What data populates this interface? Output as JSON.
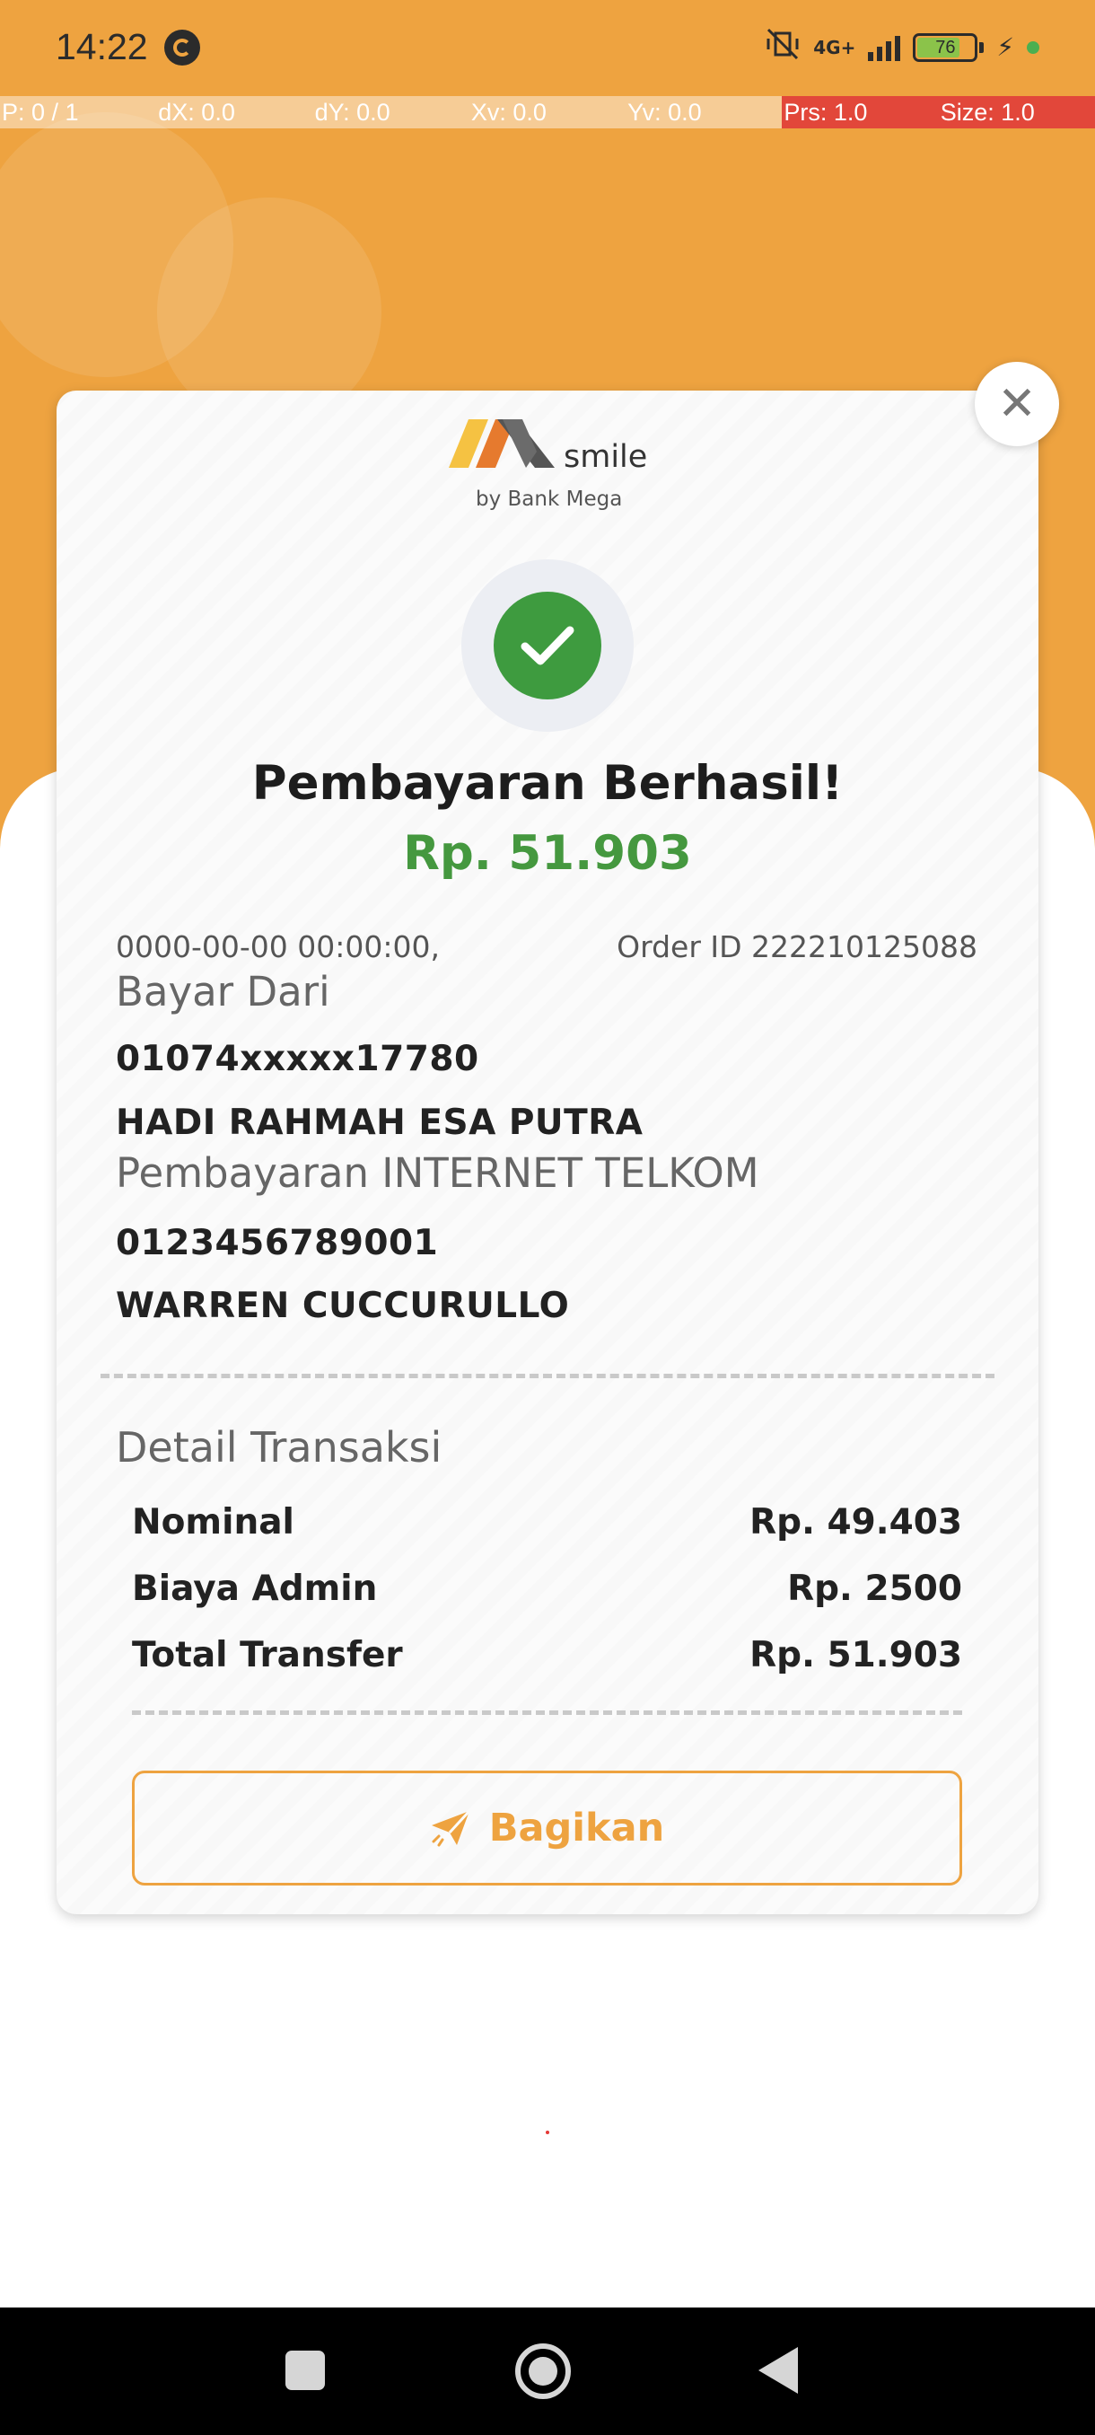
{
  "status_bar": {
    "time": "14:22",
    "network_label": "4G+",
    "battery_level": "76",
    "battery_fraction": 0.76
  },
  "debug_overlay": {
    "pointer": "P: 0 / 1",
    "dx": "dX: 0.0",
    "dy": "dY: 0.0",
    "xv": "Xv: 0.0",
    "yv": "Yv: 0.0",
    "prs": "Prs: 1.0",
    "size": "Size: 1.0"
  },
  "brand": {
    "name": "smile",
    "subtitle": "by Bank Mega"
  },
  "receipt": {
    "title": "Pembayaran Berhasil!",
    "amount": "Rp. 51.903",
    "datetime": "0000-00-00 00:00:00,",
    "order_id": "Order ID 222210125088",
    "from_label": "Bayar Dari",
    "from_account": "01074xxxxx17780",
    "from_name": "HADI RAHMAH ESA PUTRA",
    "payment_label": "Pembayaran INTERNET TELKOM",
    "customer_number": "0123456789001",
    "customer_name": "WARREN CUCCURULLO"
  },
  "details": {
    "title": "Detail Transaksi",
    "rows": [
      {
        "label": "Nominal",
        "value": "Rp. 49.403"
      },
      {
        "label": "Biaya Admin",
        "value": "Rp. 2500"
      },
      {
        "label": "Total Transfer",
        "value": "Rp. 51.903"
      }
    ]
  },
  "actions": {
    "share_label": "Bagikan"
  },
  "colors": {
    "primary_orange": "#eea340",
    "success_green": "#3e9b3f",
    "amount_green": "#45983f"
  },
  "icons": {
    "close": "close-icon",
    "success": "check-icon",
    "share": "paper-plane-icon"
  }
}
